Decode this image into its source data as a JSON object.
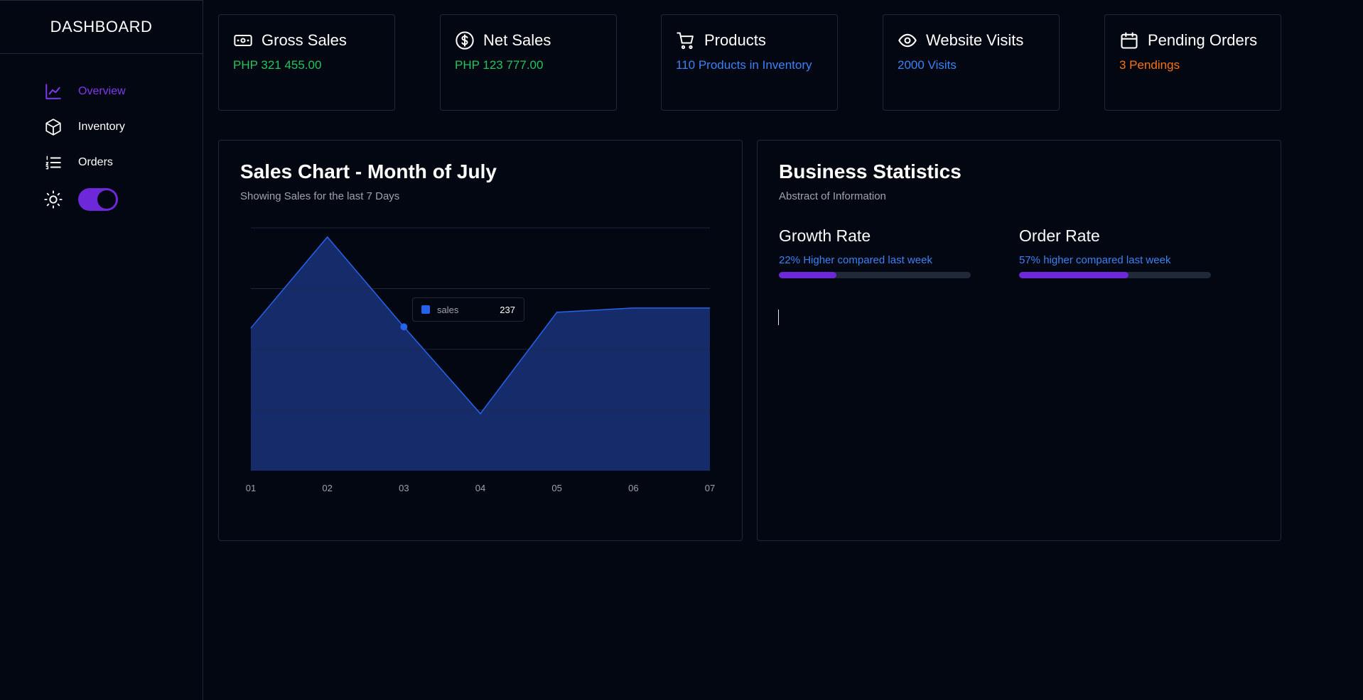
{
  "sidebar": {
    "brand": "DASHBOARD",
    "items": [
      {
        "label": "Overview",
        "icon": "line-chart-icon",
        "active": true
      },
      {
        "label": "Inventory",
        "icon": "box-icon",
        "active": false
      },
      {
        "label": "Orders",
        "icon": "list-ordered-icon",
        "active": false
      }
    ],
    "theme_toggle": {
      "icon": "sun-icon",
      "on": true
    }
  },
  "cards": [
    {
      "title": "Gross Sales",
      "value": "PHP 321 455.00",
      "icon": "banknote-icon",
      "color": "#22c55e"
    },
    {
      "title": "Net Sales",
      "value": "PHP 123 777.00",
      "icon": "dollar-circle-icon",
      "color": "#22c55e"
    },
    {
      "title": "Products",
      "value": "110 Products in Inventory",
      "icon": "cart-icon",
      "color": "#3b82f6"
    },
    {
      "title": "Website Visits",
      "value": "2000 Visits",
      "icon": "eye-icon",
      "color": "#3b82f6"
    },
    {
      "title": "Pending Orders",
      "value": "3 Pendings",
      "icon": "calendar-icon",
      "color": "#f97316"
    }
  ],
  "sales_chart": {
    "title": "Sales Chart - Month of July",
    "subtitle": "Showing Sales for the last 7 Days",
    "tooltip": {
      "label": "sales",
      "value": "237"
    }
  },
  "chart_data": {
    "type": "area",
    "categories": [
      "01",
      "02",
      "03",
      "04",
      "05",
      "06",
      "07"
    ],
    "series": [
      {
        "name": "sales",
        "values": [
          235,
          385,
          237,
          94,
          261,
          268,
          268
        ]
      }
    ],
    "ylim": [
      0,
      400
    ],
    "grid": true,
    "color": "#1e40af"
  },
  "business": {
    "title": "Business Statistics",
    "subtitle": "Abstract of Information",
    "stats": [
      {
        "name": "Growth Rate",
        "desc": "22% Higher compared last week",
        "progress": 0.3
      },
      {
        "name": "Order Rate",
        "desc": "57% higher compared last week",
        "progress": 0.57
      }
    ]
  }
}
